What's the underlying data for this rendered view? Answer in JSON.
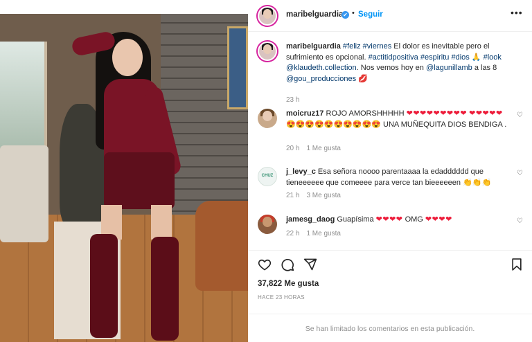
{
  "post": {
    "username": "maribelguardia",
    "follow_label": "Seguir",
    "separator": "•",
    "more_label": "•••",
    "verified_mark": "✔"
  },
  "caption": {
    "username": "maribelguardia",
    "text_1": " ",
    "tag_feliz": "#feliz",
    "tag_viernes": "#viernes",
    "text_2": " El dolor es inevitable pero el sufrimiento es opcional. ",
    "tag_actitud": "#actitidpositiva",
    "tag_espiritu": "#espiritu",
    "tag_dios": "#dios",
    "emoji_pray": "🙏",
    "tag_look": "#look",
    "mention_klaudeth": "@klaudeth.collection",
    "text_3": ". Nos vemos hoy en ",
    "mention_lagunilla": "@lagunillamb",
    "text_4": " a las 8 ",
    "mention_gou": "@gou_producciones",
    "emoji_kiss": "💋",
    "time": "23 h"
  },
  "comments": [
    {
      "username": "moicruz17",
      "text_a": "ROJO AMORSHHHHH",
      "hearts_a": "❤❤❤❤❤❤❤❤❤",
      "hearts_b": "❤❤❤❤❤",
      "emojis": "😍😍😍😍😍😍😍😍😍😍",
      "text_b": "UNA MUÑEQUITA DIOS BENDIGA .",
      "time": "20 h",
      "likes": "1 Me gusta"
    },
    {
      "username": "j_levy_c",
      "text": "Esa señora noooo parentaaaa la edadddddd que tieneeeeee que comeeee para verce tan bieeeeeen",
      "emojis": "👏👏👏",
      "time": "21 h",
      "likes": "3 Me gusta",
      "avatar_label": "CHUZ"
    },
    {
      "username": "jamesg_daog",
      "text_a": "Guapísima",
      "hearts_a": "❤❤❤❤",
      "text_b": "OMG",
      "hearts_b": "❤❤❤❤",
      "time": "22 h",
      "likes": "1 Me gusta"
    }
  ],
  "actions": {
    "likes": "37,822 Me gusta",
    "time_ago": "HACE 23 HORAS"
  },
  "footer": {
    "text": "Se han limitado los comentarios en esta publicación."
  },
  "colors": {
    "link_blue": "#0095f6",
    "tag_blue": "#00376b",
    "heart_red": "#ed1c3a",
    "muted": "#8e8e8e"
  }
}
